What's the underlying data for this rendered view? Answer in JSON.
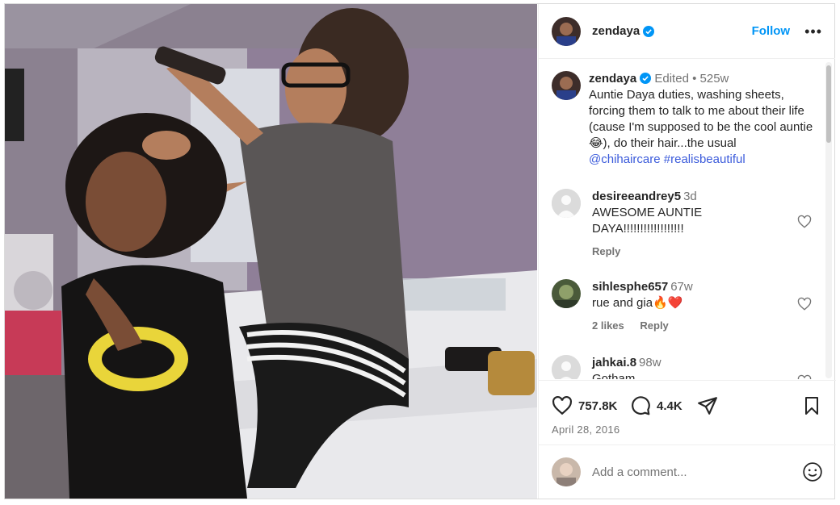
{
  "post": {
    "author": "zendaya",
    "follow_label": "Follow",
    "more_label": "•••"
  },
  "caption": {
    "author": "zendaya",
    "edited_label": "Edited",
    "separator": "•",
    "age": "525w",
    "text": "Auntie Daya duties, washing sheets, forcing them to talk to me about their life (cause I'm supposed to be the cool auntie😂), do their hair...the usual",
    "mention": "@chihaircare",
    "hashtag": "#realisbeautiful"
  },
  "comments": [
    {
      "username": "desireeandrey5",
      "time": "3d",
      "text": "AWESOME AUNTIE DAYA!!!!!!!!!!!!!!!!!!",
      "likes": "",
      "reply_label": "Reply",
      "avatar": "default-avatar"
    },
    {
      "username": "sihlesphe657",
      "time": "67w",
      "text": "rue and gia🔥❤️",
      "likes": "2 likes",
      "reply_label": "Reply",
      "avatar": "photo-avatar"
    },
    {
      "username": "jahkai.8",
      "time": "98w",
      "text": "Gotham",
      "likes": "",
      "reply_label": "",
      "avatar": "default-avatar"
    }
  ],
  "actions": {
    "like_count": "757.8K",
    "comment_count": "4.4K",
    "date": "April 28, 2016"
  },
  "add_comment": {
    "placeholder": "Add a comment..."
  },
  "colors": {
    "follow_blue": "#0095f6",
    "link_blue": "#3b5bdb",
    "verified_blue": "#0095f6",
    "muted_gray": "#737373",
    "border": "#dbdbdb"
  },
  "icons": [
    "verified-badge-icon",
    "more-options-icon",
    "heart-icon",
    "comment-icon",
    "share-icon",
    "bookmark-icon",
    "emoji-icon"
  ]
}
